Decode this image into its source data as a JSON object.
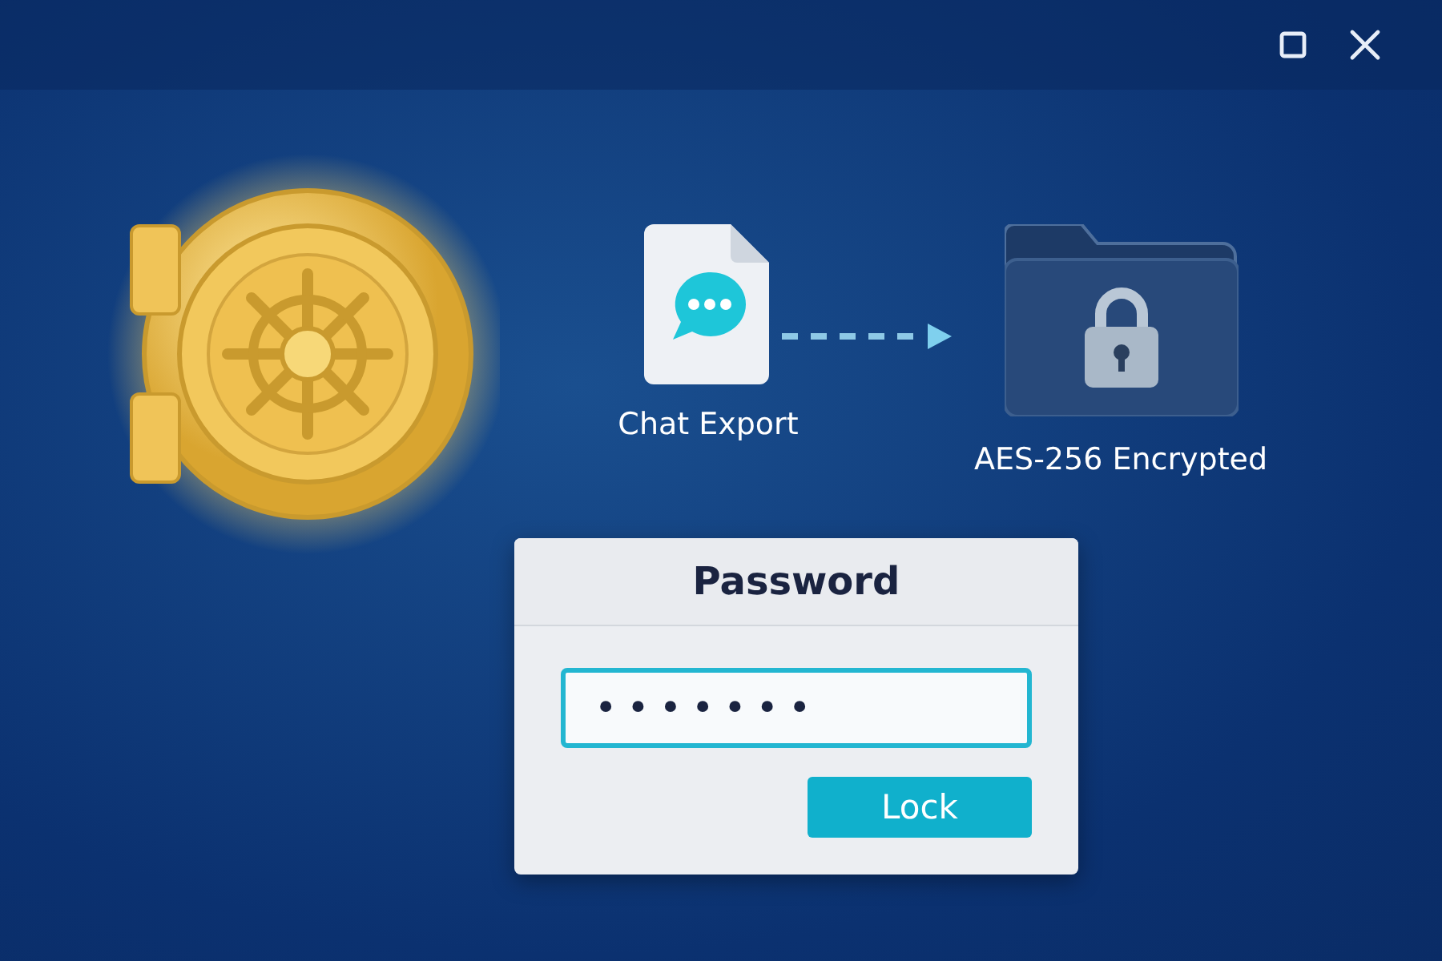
{
  "window": {
    "controls": [
      {
        "kind": "maximize"
      },
      {
        "kind": "close"
      }
    ]
  },
  "flow": {
    "source_label": "Chat Export",
    "target_label": "AES-256 Encrypted"
  },
  "dialog": {
    "title": "Password",
    "password_value": "•••••••",
    "button": "Lock"
  }
}
